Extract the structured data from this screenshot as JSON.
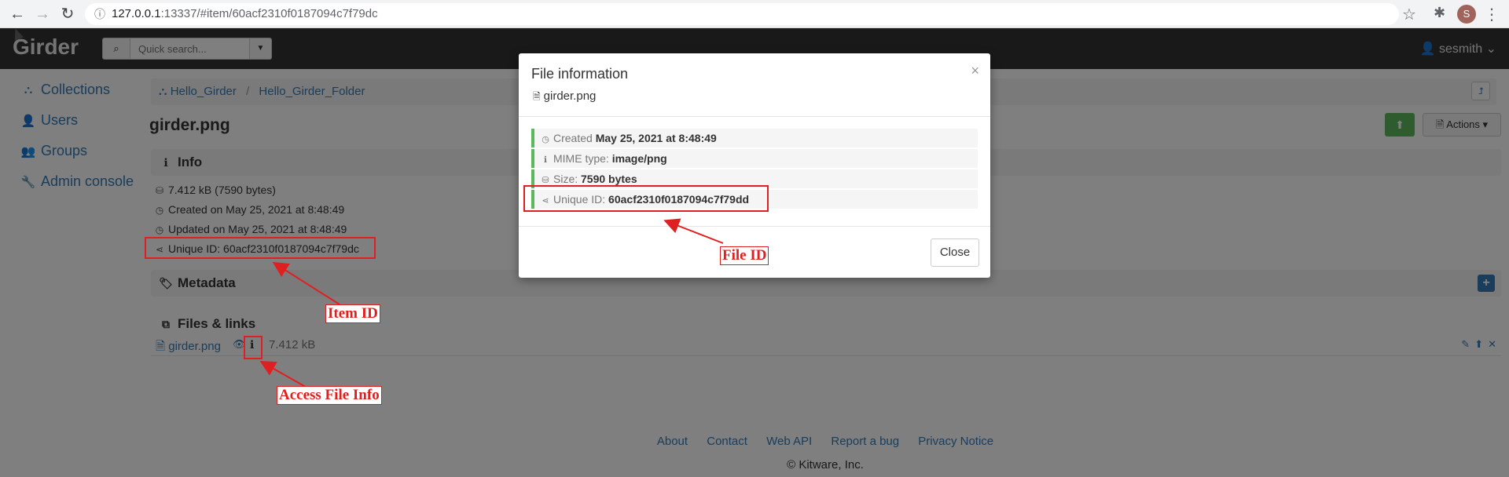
{
  "browser": {
    "url_host": "127.0.0.1",
    "url_rest": ":13337/#item/60acf2310f0187094c7f79dc",
    "profile_initial": "S"
  },
  "topbar": {
    "logo": "Girder",
    "search_placeholder": "Quick search...",
    "username": "sesmith"
  },
  "sidebar": {
    "items": [
      {
        "label": "Collections",
        "icon": "sitemap-icon"
      },
      {
        "label": "Users",
        "icon": "user-icon"
      },
      {
        "label": "Groups",
        "icon": "users-icon"
      },
      {
        "label": "Admin console",
        "icon": "wrench-icon"
      }
    ]
  },
  "breadcrumb": {
    "root": "Hello_Girder",
    "folder": "Hello_Girder_Folder"
  },
  "item": {
    "title": "girder.png",
    "actions_label": "Actions",
    "info_header": "Info",
    "size": "7.412 kB (7590 bytes)",
    "created": "Created on May 25, 2021 at 8:48:49",
    "updated": "Updated on May 25, 2021 at 8:48:49",
    "unique_id": "Unique ID: 60acf2310f0187094c7f79dc",
    "metadata_header": "Metadata",
    "files_header": "Files & links",
    "file_name": "girder.png",
    "file_size": "7.412 kB"
  },
  "footer": {
    "links": [
      "About",
      "Contact",
      "Web API",
      "Report a bug",
      "Privacy Notice"
    ],
    "copyright": "© Kitware, Inc."
  },
  "modal": {
    "title": "File information",
    "file_name": "girder.png",
    "created_label": "Created",
    "created_value": "May 25, 2021 at 8:48:49",
    "mime_label": "MIME type:",
    "mime_value": "image/png",
    "size_label": "Size:",
    "size_value": "7590 bytes",
    "uid_label": "Unique ID:",
    "uid_value": "60acf2310f0187094c7f79dd",
    "close_label": "Close"
  },
  "annotations": {
    "item_id": "Item ID",
    "file_id": "File ID",
    "access_file_info": "Access File Info",
    "color": "#e02020"
  },
  "colors": {
    "link": "#337ab7",
    "topbar": "#333333",
    "success": "#5cb85c"
  }
}
